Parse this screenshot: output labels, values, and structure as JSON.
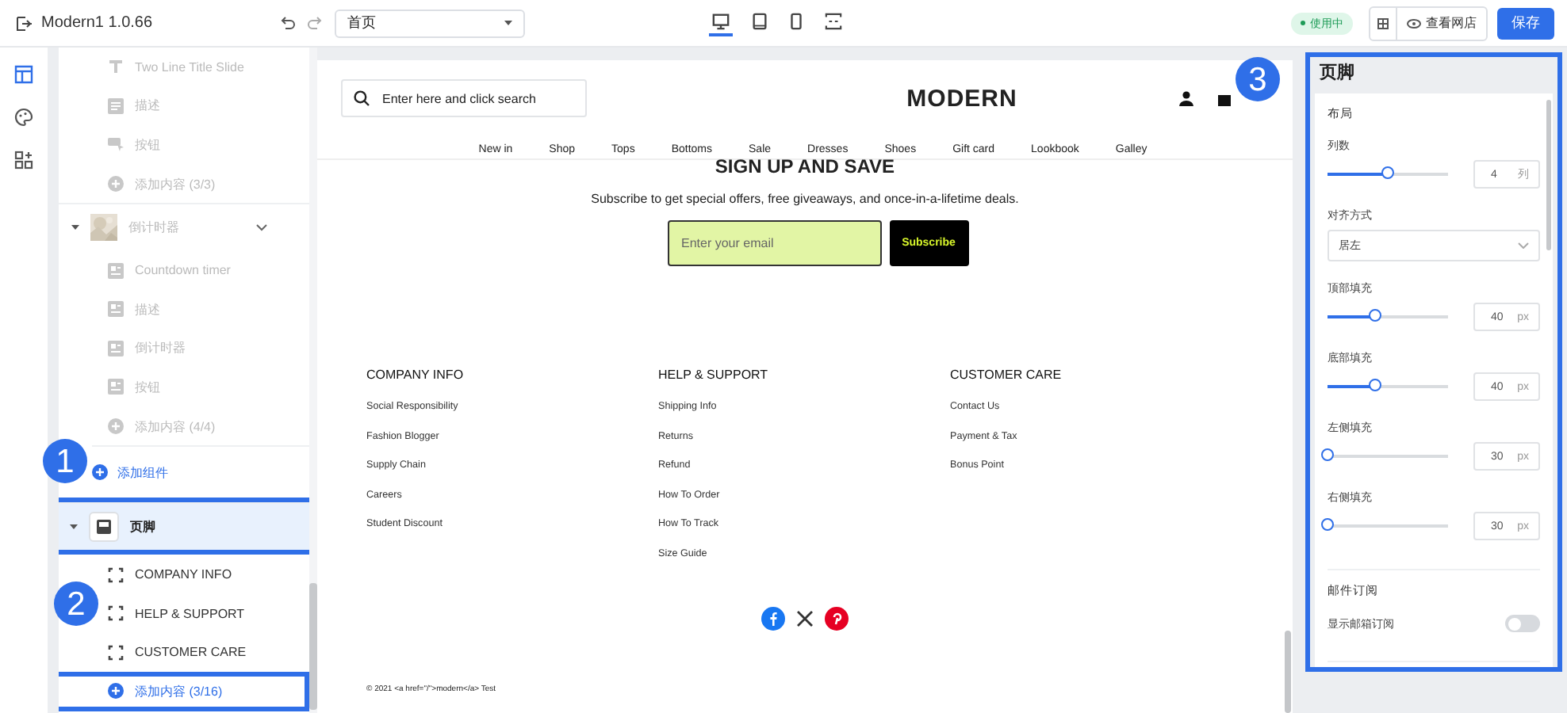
{
  "topbar": {
    "title": "Modern1 1.0.66",
    "page_select": "首页",
    "devices": [
      {
        "kind": "desktop",
        "selected": true
      },
      {
        "kind": "tablet",
        "selected": false
      },
      {
        "kind": "mobile",
        "selected": false
      },
      {
        "kind": "fullscreen",
        "selected": false
      }
    ],
    "status": "使用中",
    "view_store": "查看网店",
    "save": "保存"
  },
  "rail": [
    {
      "kind": "sections",
      "selected": true
    },
    {
      "kind": "theme",
      "selected": false
    },
    {
      "kind": "apps",
      "selected": false
    }
  ],
  "tree": {
    "groups": [
      {
        "dimmed": true,
        "items": [
          {
            "kind": "title",
            "label": "Two Line Title Slide"
          },
          {
            "kind": "text",
            "label": "描述"
          },
          {
            "kind": "button",
            "label": "按钮"
          },
          {
            "kind": "add",
            "label": "添加内容 (3/3)",
            "highlighted": false
          }
        ]
      },
      {
        "header": {
          "label": "倒计时器",
          "selected": false,
          "highlighted": false
        },
        "dimmed": true,
        "items": [
          {
            "kind": "block",
            "label": "Countdown timer"
          },
          {
            "kind": "block",
            "label": "描述"
          },
          {
            "kind": "block",
            "label": "倒计时器"
          },
          {
            "kind": "block",
            "label": "按钮"
          },
          {
            "kind": "add",
            "label": "添加内容 (4/4)",
            "highlighted": false
          }
        ]
      },
      {
        "add_section": "添加组件"
      },
      {
        "header": {
          "label": "页脚",
          "selected": true,
          "highlighted": true
        },
        "dimmed": false,
        "items": [
          {
            "kind": "column",
            "label": "COMPANY INFO"
          },
          {
            "kind": "column",
            "label": "HELP & SUPPORT"
          },
          {
            "kind": "column",
            "label": "CUSTOMER CARE"
          },
          {
            "kind": "add",
            "label": "添加内容 (3/16)",
            "highlighted": true
          }
        ]
      }
    ]
  },
  "preview": {
    "search_placeholder": "Enter here and click search",
    "logo": "MODERN",
    "nav": [
      "New in",
      "Shop",
      "Tops",
      "Bottoms",
      "Sale",
      "Dresses",
      "Shoes",
      "Gift card",
      "Lookbook",
      "Galley"
    ],
    "signup": {
      "title": "SIGN UP AND SAVE",
      "text": "Subscribe to get special offers, free giveaways, and once-in-a-lifetime deals.",
      "placeholder": "Enter your email",
      "button": "Subscribe"
    },
    "columns": [
      {
        "heading": "COMPANY INFO",
        "links": [
          "Social Responsibility",
          "Fashion Blogger",
          "Supply Chain",
          "Careers",
          "Student Discount"
        ]
      },
      {
        "heading": "HELP & SUPPORT",
        "links": [
          "Shipping Info",
          "Returns",
          "Refund",
          "How To Order",
          "How To Track",
          "Size Guide"
        ]
      },
      {
        "heading": "CUSTOMER CARE",
        "links": [
          "Contact Us",
          "Payment & Tax",
          "Bonus Point"
        ]
      }
    ],
    "social": [
      {
        "kind": "facebook",
        "color": "#1877f2"
      },
      {
        "kind": "x",
        "color": "#333333"
      },
      {
        "kind": "pinterest",
        "color": "#e60023"
      }
    ],
    "copyright": "© 2021 <a href=\"/\">modern</a> Test"
  },
  "settings": {
    "title": "页脚",
    "highlighted": true,
    "sections": [
      {
        "title": "布局",
        "controls": [
          {
            "kind": "slider",
            "label": "列数",
            "level": 0.5,
            "value": "4",
            "unit": "列"
          },
          {
            "kind": "select",
            "label": "对齐方式",
            "value": "居左"
          },
          {
            "kind": "slider",
            "label": "顶部填充",
            "level": 0.4,
            "value": "40",
            "unit": "px"
          },
          {
            "kind": "slider",
            "label": "底部填充",
            "level": 0.4,
            "value": "40",
            "unit": "px"
          },
          {
            "kind": "slider",
            "label": "左侧填充",
            "level": 0,
            "value": "30",
            "unit": "px"
          },
          {
            "kind": "slider",
            "label": "右侧填充",
            "level": 0,
            "value": "30",
            "unit": "px"
          }
        ]
      },
      {
        "title": "邮件订阅",
        "controls": [
          {
            "kind": "toggle",
            "label": "显示邮箱订阅",
            "on": false
          }
        ]
      }
    ]
  },
  "annotations": [
    {
      "label": "1"
    },
    {
      "label": "2"
    },
    {
      "label": "3"
    }
  ]
}
